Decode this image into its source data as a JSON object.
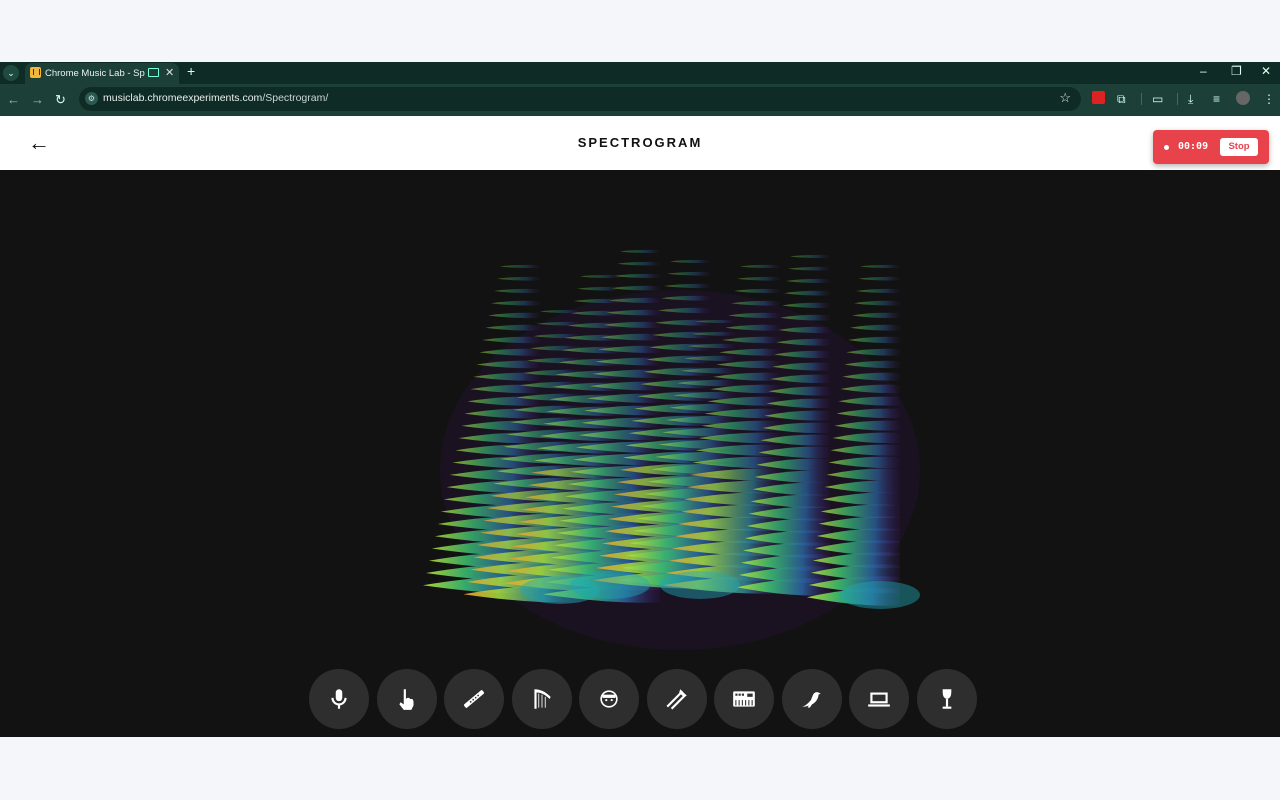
{
  "browser": {
    "tab_title": "Chrome Music Lab - Spectr",
    "url_host": "musiclab.chromeexperiments.com",
    "url_path": "/Spectrogram/"
  },
  "page": {
    "title": "SPECTROGRAM"
  },
  "recorder": {
    "time": "00:09",
    "stop_label": "Stop",
    "color": "#e8424a"
  },
  "instruments": [
    {
      "name": "microphone",
      "icon": "microphone-icon"
    },
    {
      "name": "draw",
      "icon": "hand-pointer-icon"
    },
    {
      "name": "flute",
      "icon": "flute-icon"
    },
    {
      "name": "harp",
      "icon": "harp-icon"
    },
    {
      "name": "voice",
      "icon": "face-icon"
    },
    {
      "name": "trombone",
      "icon": "trombone-icon"
    },
    {
      "name": "synth",
      "icon": "synth-icon"
    },
    {
      "name": "bird",
      "icon": "bird-icon"
    },
    {
      "name": "computer",
      "icon": "laptop-icon"
    },
    {
      "name": "wine glass",
      "icon": "wineglass-icon"
    }
  ]
}
